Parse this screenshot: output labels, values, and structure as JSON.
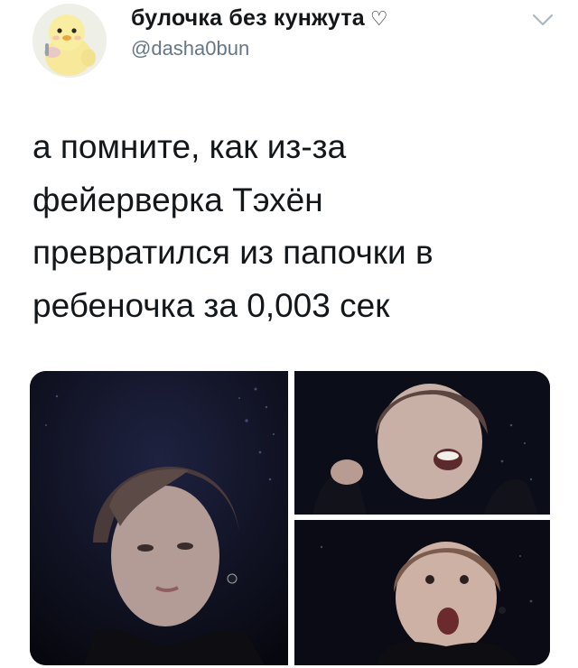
{
  "user": {
    "display_name": "булочка без кунжута",
    "heart": "♡",
    "handle": "@dasha0bun"
  },
  "tweet": {
    "lines": [
      "а помните, как из-за",
      "фейерверка Тэхён",
      "превратился из папочки в",
      "ребеночка за 0,003 сек"
    ]
  },
  "icons": {
    "avatar": "duckling-avatar",
    "caret": "chevron-down-icon",
    "heart": "heart-outline-icon"
  },
  "colors": {
    "text": "#14171a",
    "secondary": "#657786",
    "background": "#ffffff"
  }
}
